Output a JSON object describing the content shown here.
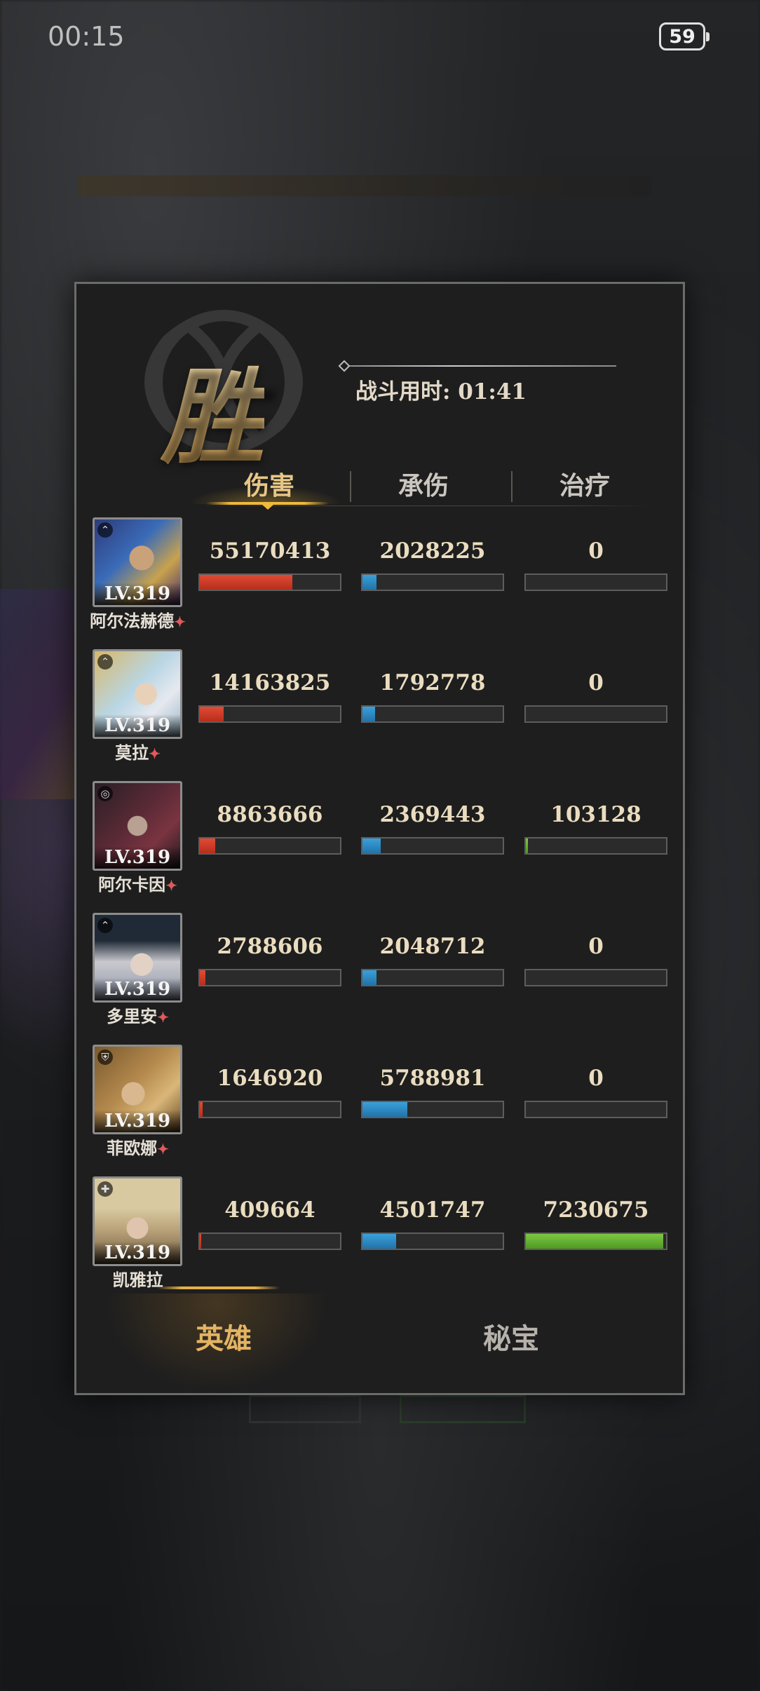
{
  "status_bar": {
    "time": "00:15",
    "battery": "59"
  },
  "result": {
    "victory_label": "胜",
    "battle_time": "战斗用时: 01:41"
  },
  "tabs": [
    {
      "label": "伤害",
      "active": true
    },
    {
      "label": "承伤",
      "active": false
    },
    {
      "label": "治疗",
      "active": false
    }
  ],
  "heroes": [
    {
      "name": "阿尔法赫德",
      "level": "LV.319",
      "damage": "55170413",
      "damage_frac": 0.66,
      "taken": "2028225",
      "taken_frac": 0.1,
      "heal": "0",
      "heal_frac": 0.0
    },
    {
      "name": "莫拉",
      "level": "LV.319",
      "damage": "14163825",
      "damage_frac": 0.17,
      "taken": "1792778",
      "taken_frac": 0.09,
      "heal": "0",
      "heal_frac": 0.0
    },
    {
      "name": "阿尔卡因",
      "level": "LV.319",
      "damage": "8863666",
      "damage_frac": 0.11,
      "taken": "2369443",
      "taken_frac": 0.13,
      "heal": "103128",
      "heal_frac": 0.015
    },
    {
      "name": "多里安",
      "level": "LV.319",
      "damage": "2788606",
      "damage_frac": 0.04,
      "taken": "2048712",
      "taken_frac": 0.1,
      "heal": "0",
      "heal_frac": 0.0
    },
    {
      "name": "菲欧娜",
      "level": "LV.319",
      "damage": "1646920",
      "damage_frac": 0.02,
      "taken": "5788981",
      "taken_frac": 0.32,
      "heal": "0",
      "heal_frac": 0.0
    },
    {
      "name": "凯雅拉",
      "level": "LV.319",
      "damage": "409664",
      "damage_frac": 0.01,
      "taken": "4501747",
      "taken_frac": 0.24,
      "heal": "7230675",
      "heal_frac": 0.98
    }
  ],
  "bottom_tabs": [
    {
      "label": "英雄",
      "active": true
    },
    {
      "label": "秘宝",
      "active": false
    }
  ],
  "colors": {
    "damage": "#d23a24",
    "taken": "#2f8bc4",
    "heal": "#6bbb36",
    "gold_accent": "#f0b93b"
  }
}
